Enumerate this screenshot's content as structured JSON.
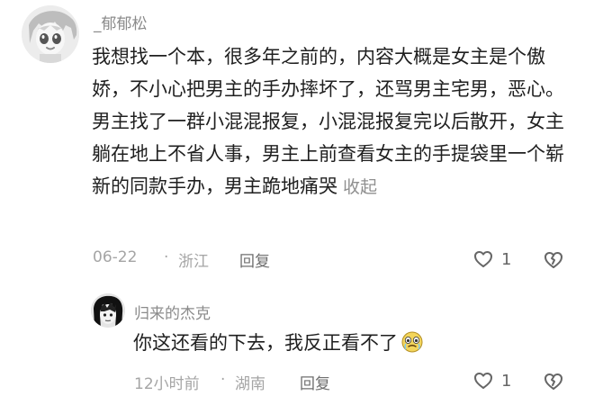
{
  "main_comment": {
    "username": "_郁郁松",
    "text": "我想找一个本，很多年之前的，内容大概是女主是个傲娇，不小心把男主的手办摔坏了，还骂男主宅男，恶心。男主找了一群小混混报复，小混混报复完以后散开，女主躺在地上不省人事，男主上前查看女主的手提袋里一个崭新的同款手办，男主跪地痛哭",
    "collapse_label": "收起",
    "date": "06-22",
    "location": "浙江",
    "reply_label": "回复",
    "like_count": "1",
    "separator": "·",
    "avatar_icon": "anime-avatar-icon"
  },
  "reply_comment": {
    "username": "归来的杰克",
    "text": "你这还看的下去，我反正看不了",
    "date": "12小时前",
    "location": "湖南",
    "reply_label": "回复",
    "like_count": "1",
    "separator": "·",
    "avatar_icon": "black-hair-avatar-icon",
    "emoji_icon": "crying-emoji-icon"
  },
  "colors": {
    "text": "#1f1f1f",
    "secondary": "#8b8b8b",
    "meta": "#a5a5a5",
    "icon": "#666666",
    "background": "#ffffff"
  }
}
